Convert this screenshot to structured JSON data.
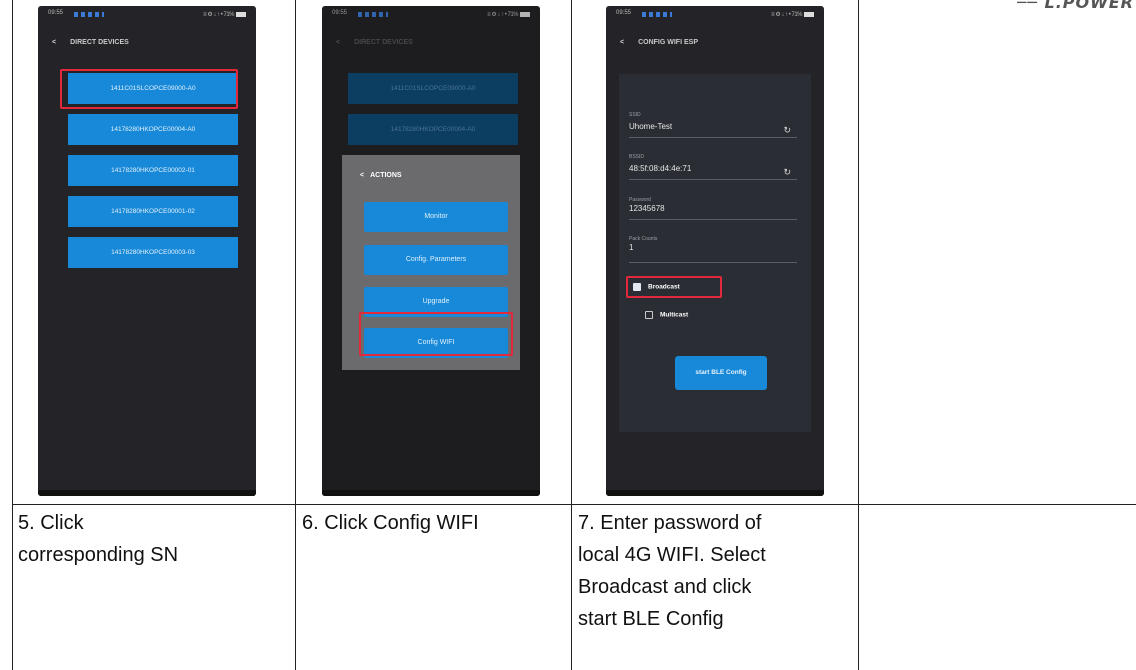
{
  "logo_text": "── L.POWER",
  "steps": [
    {
      "caption_lines": [
        "5. Click",
        "corresponding SN"
      ],
      "phone": {
        "status": {
          "time": "09:55",
          "right": "≡ ⚙ ↓ ↑ • 71%"
        },
        "header": {
          "back": "<",
          "title": "DIRECT DEVICES"
        },
        "sn_items": [
          "1411C01SLCOPCE09000-A0",
          "14178280HKOPCE00004-A0",
          "14178280HKOPCE00002-01",
          "14178280HKOPCE00001-02",
          "14178280HKOPCE00003-03"
        ]
      }
    },
    {
      "caption_lines": [
        "6. Click Config WIFI"
      ],
      "phone": {
        "status": {
          "time": "09:55",
          "right": "≡ ⚙ ↓ ↑ • 71%"
        },
        "header": {
          "back": "<",
          "title": "DIRECT DEVICES"
        },
        "sn_items": [
          "1411C01SLCOPCE09000-A0",
          "14178280HKOPCE00004-A0"
        ],
        "dialog": {
          "back": "<",
          "title": "ACTIONS",
          "buttons": [
            "Monitor",
            "Config. Parameters",
            "Upgrade",
            "Config WIFI"
          ]
        }
      }
    },
    {
      "caption_lines": [
        "7. Enter password of",
        "local 4G WIFI. Select",
        "Broadcast and click",
        "start BLE Config"
      ],
      "phone": {
        "status": {
          "time": "09:55",
          "right": "≡ ⚙ ↓ ↑ • 71%"
        },
        "header": {
          "back": "<",
          "title": "CONFIG WIFI ESP"
        },
        "form": {
          "ssid_label": "SSID",
          "ssid_value": "Uhome-Test",
          "bssid_label": "BSSID",
          "bssid_value": "48:5f:08:d4:4e:71",
          "password_label": "Password",
          "password_value": "12345678",
          "pack_count_label": "Pack Counts",
          "pack_count_value": "1",
          "refresh_symbol": "↻",
          "broadcast_label": "Broadcast",
          "multicast_label": "Multicast",
          "submit_label": "start BLE Config"
        }
      }
    }
  ],
  "highlight_color": "#e2283a",
  "button_color": "#1789d8"
}
